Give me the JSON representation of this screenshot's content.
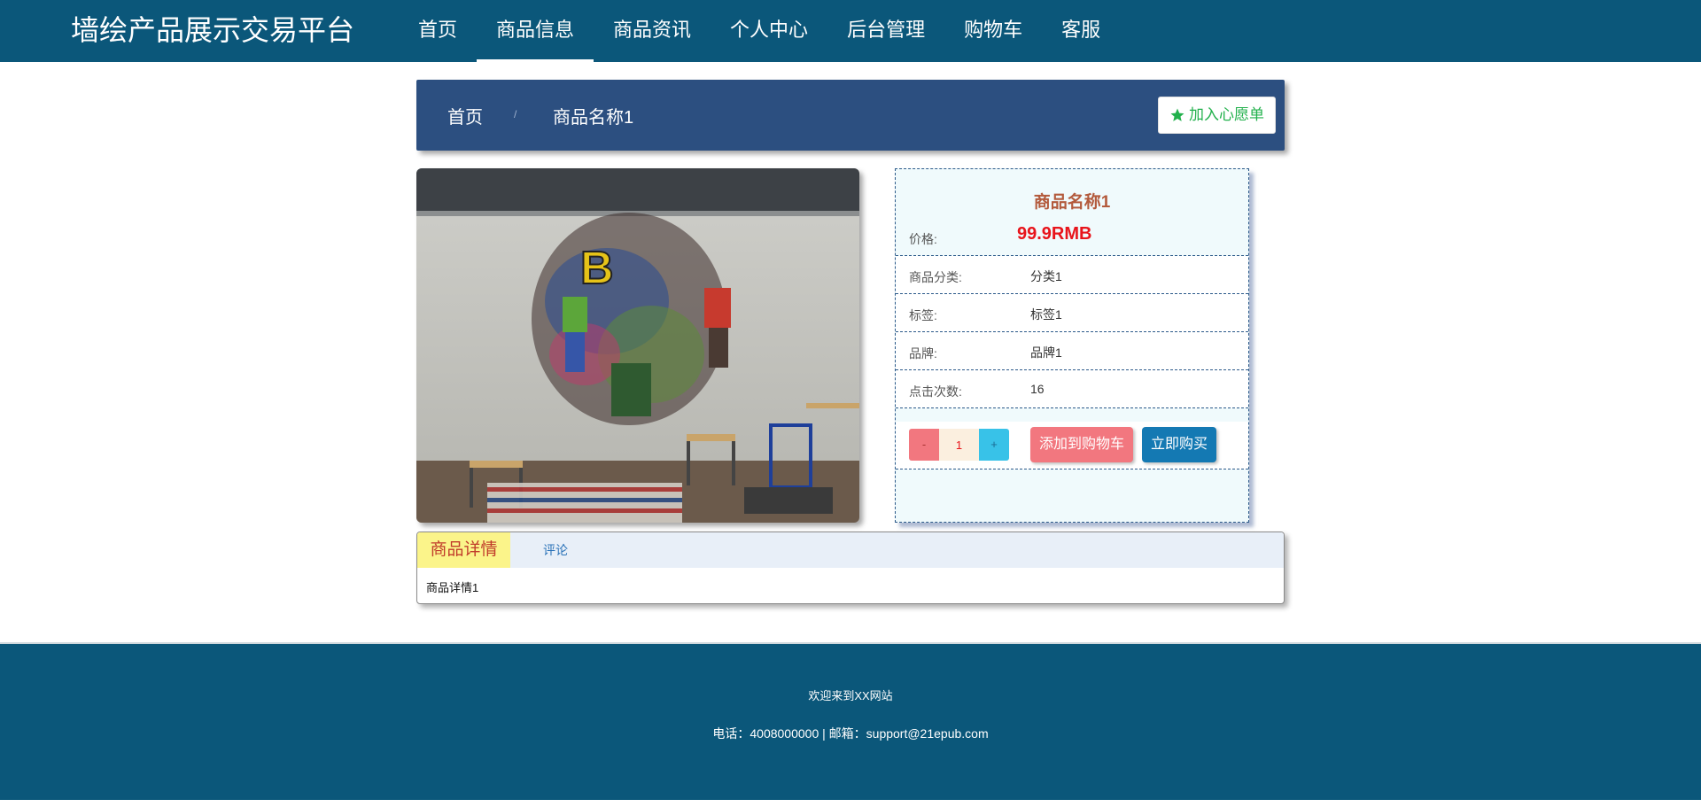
{
  "header": {
    "brand": "墙绘产品展示交易平台",
    "nav": [
      {
        "label": "首页"
      },
      {
        "label": "商品信息"
      },
      {
        "label": "商品资讯"
      },
      {
        "label": "个人中心"
      },
      {
        "label": "后台管理"
      },
      {
        "label": "购物车"
      },
      {
        "label": "客服"
      }
    ],
    "active_nav": "商品信息",
    "background": "#0b577a"
  },
  "breadcrumb": {
    "home": "首页",
    "separator": "/",
    "current": "商品名称1",
    "wishlist_label": "加入心愿单",
    "wishlist_icon": "star-icon"
  },
  "product": {
    "name": "商品名称1",
    "price_label": "价格:",
    "price": "99.9RMB",
    "category_label": "商品分类:",
    "category": "分类1",
    "tag_label": "标签:",
    "tag": "标签1",
    "brand_label": "品牌:",
    "brand": "品牌1",
    "clicks_label": "点击次数:",
    "clicks": "16",
    "image_alt": "graffiti mural photo"
  },
  "purchase": {
    "minus": "-",
    "quantity": "1",
    "plus": "+",
    "add_to_cart": "添加到购物车",
    "buy_now": "立即购买"
  },
  "tabs": {
    "detail_label": "商品详情",
    "comment_label": "评论",
    "detail_content": "商品详情1"
  },
  "footer": {
    "welcome": "欢迎来到XX网站",
    "contact": "电话：4008000000 | 邮箱：support@21epub.com"
  },
  "colors": {
    "header_bg": "#0b577a",
    "breadcrumb_bg": "#2c4f80",
    "price": "#e8141b",
    "title": "#b35a3c",
    "cart_btn": "#f2777f",
    "buy_btn": "#1479b3",
    "wishlist": "#22b14c"
  }
}
